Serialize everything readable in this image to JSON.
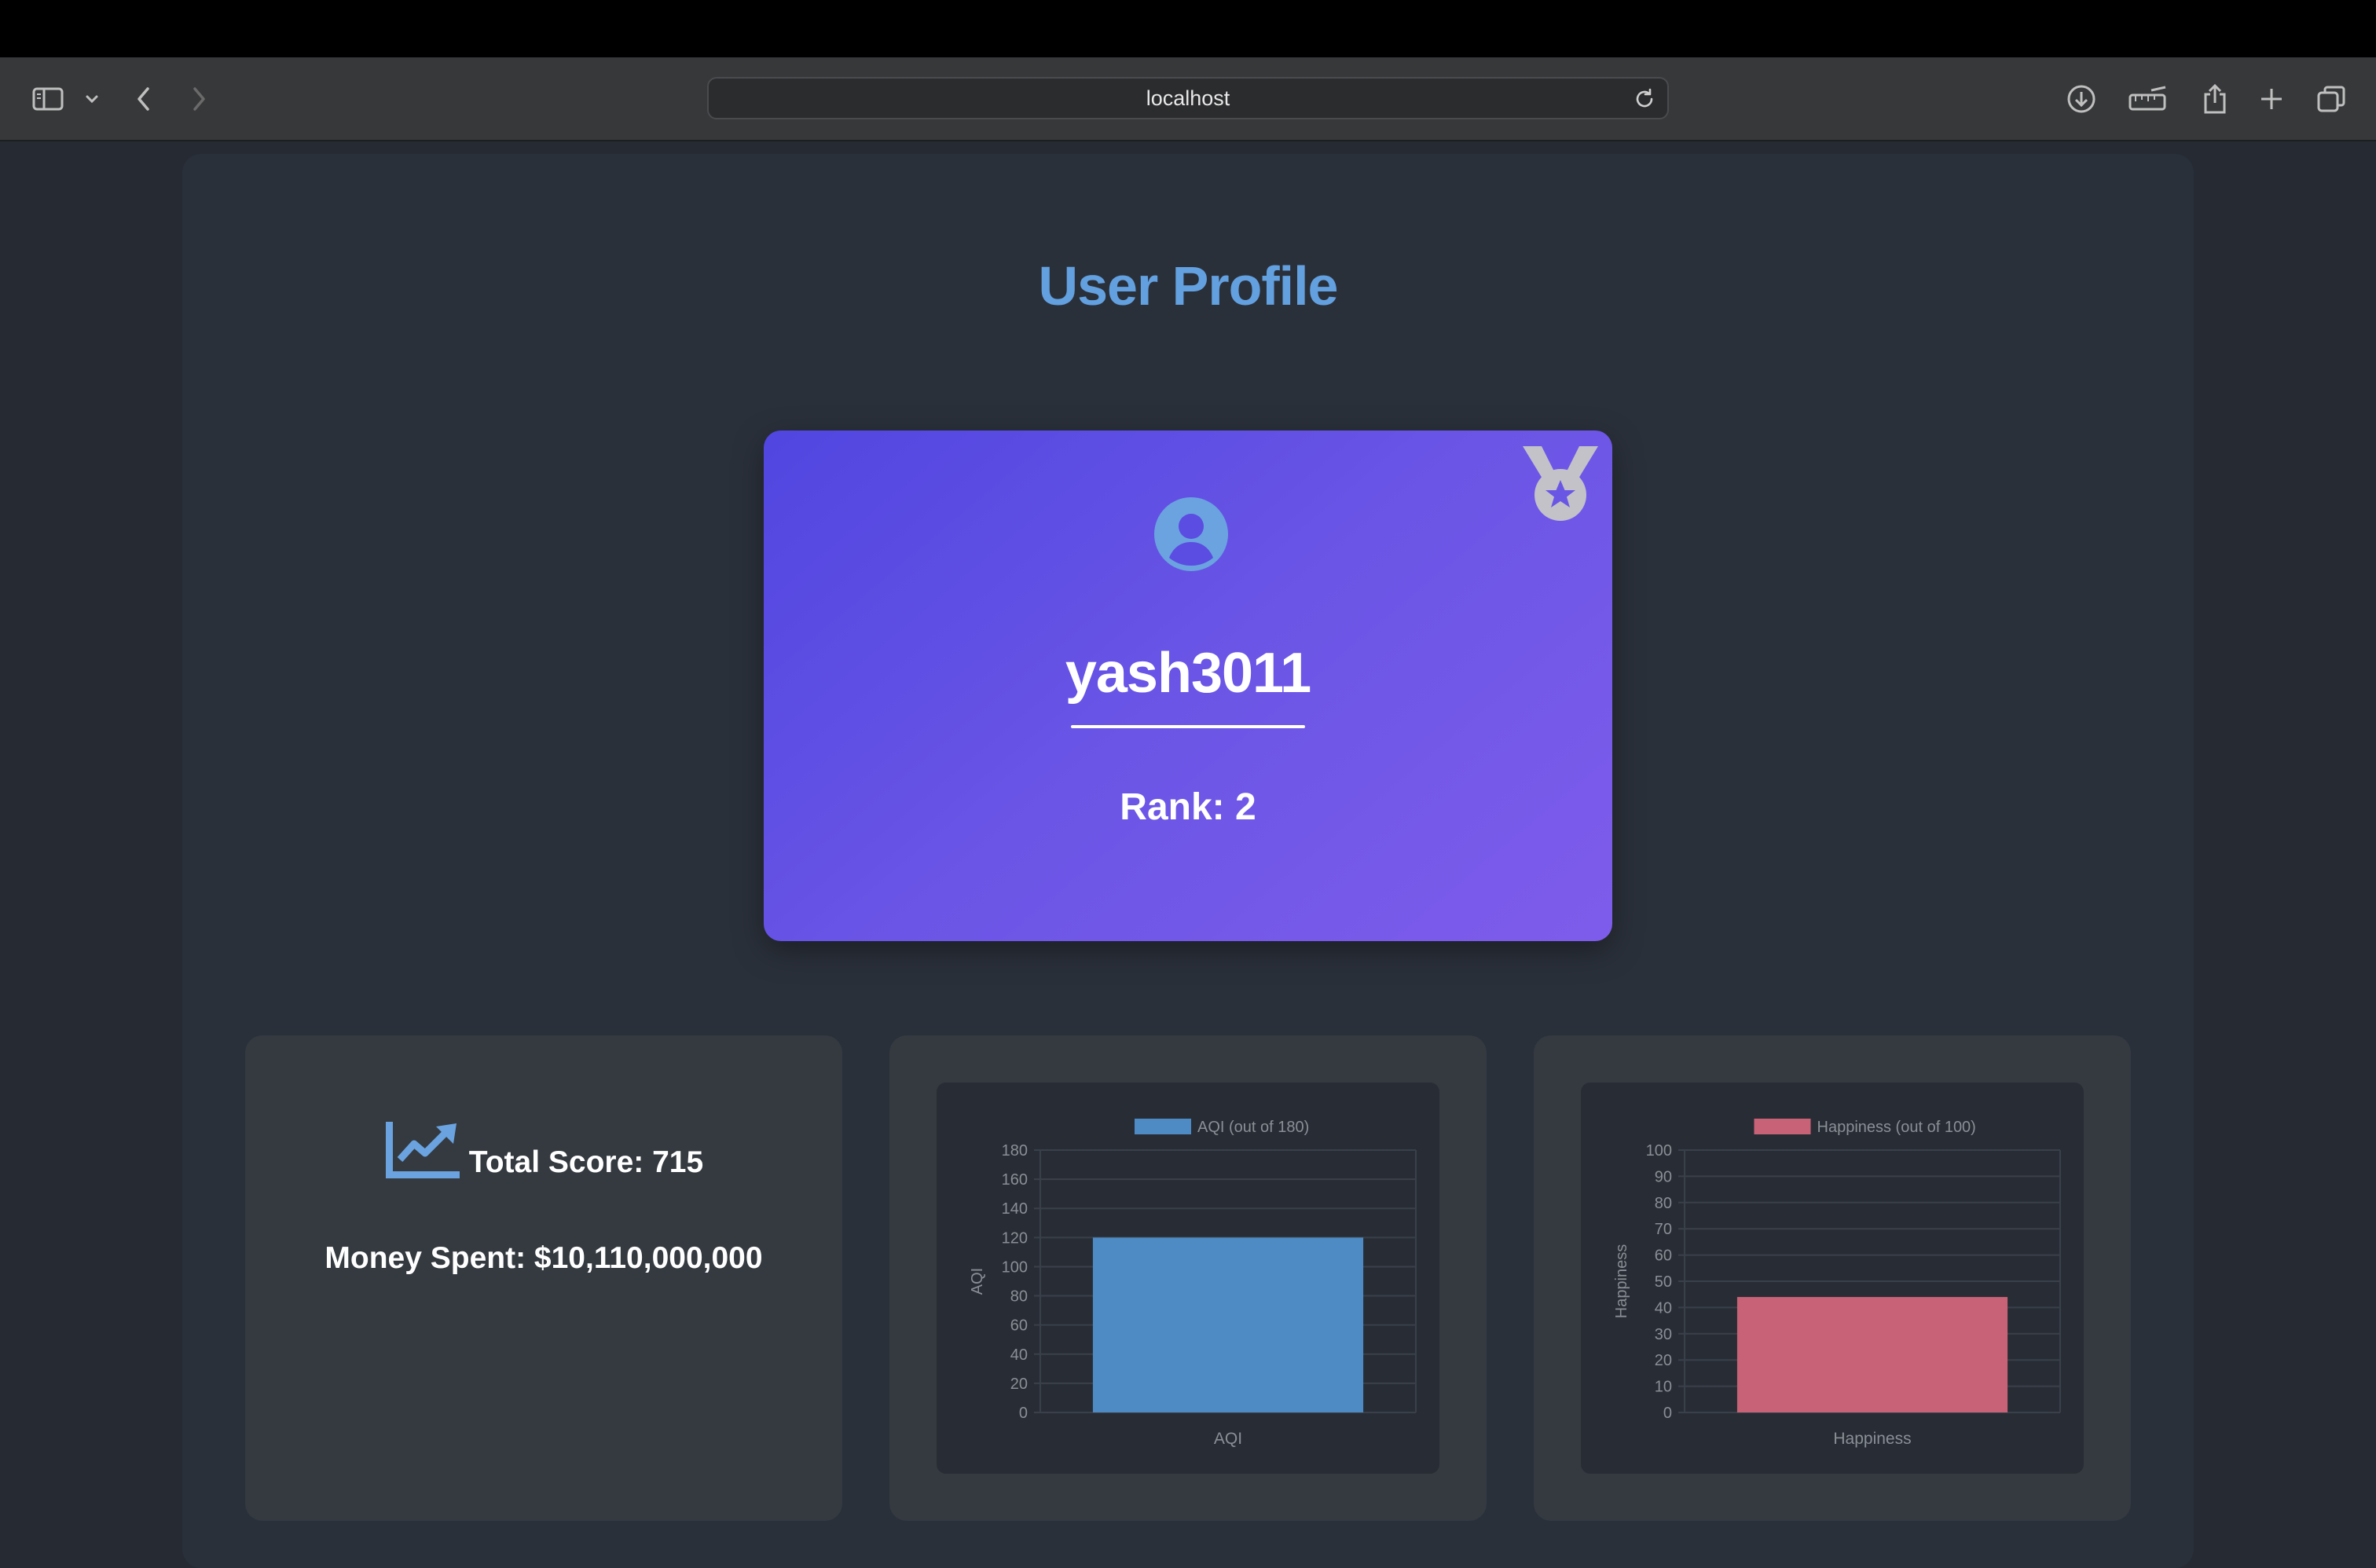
{
  "browser": {
    "url": "localhost"
  },
  "page": {
    "title": "User Profile"
  },
  "profile": {
    "username": "yash3011",
    "rank_text": "Rank: 2"
  },
  "stats": {
    "total_score_text": "Total Score: 715",
    "money_spent_text": "Money Spent: $10,110,000,000"
  },
  "icons": {
    "avatar": "user-circle-icon",
    "medal": "medal-icon",
    "score": "chart-line-icon"
  },
  "colors": {
    "title": "#63a0df",
    "card_gradient_start": "#5046e0",
    "card_gradient_end": "#7f5ceb",
    "aqi_bar": "#4e8ac4",
    "happiness_bar": "#c86276"
  },
  "chart_data": [
    {
      "type": "bar",
      "categories": [
        "AQI"
      ],
      "series": [
        {
          "name": "AQI (out of 180)",
          "values": [
            120
          ]
        }
      ],
      "xlabel": "AQI",
      "ylabel": "AQI",
      "ylim": [
        0,
        180
      ],
      "yticks": [
        0,
        20,
        40,
        60,
        80,
        100,
        120,
        140,
        160,
        180
      ],
      "grid": true,
      "legend": "top-center",
      "color": "#4e8ac4"
    },
    {
      "type": "bar",
      "categories": [
        "Happiness"
      ],
      "series": [
        {
          "name": "Happiness (out of 100)",
          "values": [
            44
          ]
        }
      ],
      "xlabel": "Happiness",
      "ylabel": "Happiness",
      "ylim": [
        0,
        100
      ],
      "yticks": [
        0,
        10,
        20,
        30,
        40,
        50,
        60,
        70,
        80,
        90,
        100
      ],
      "grid": true,
      "legend": "top-center",
      "color": "#c86276"
    }
  ]
}
